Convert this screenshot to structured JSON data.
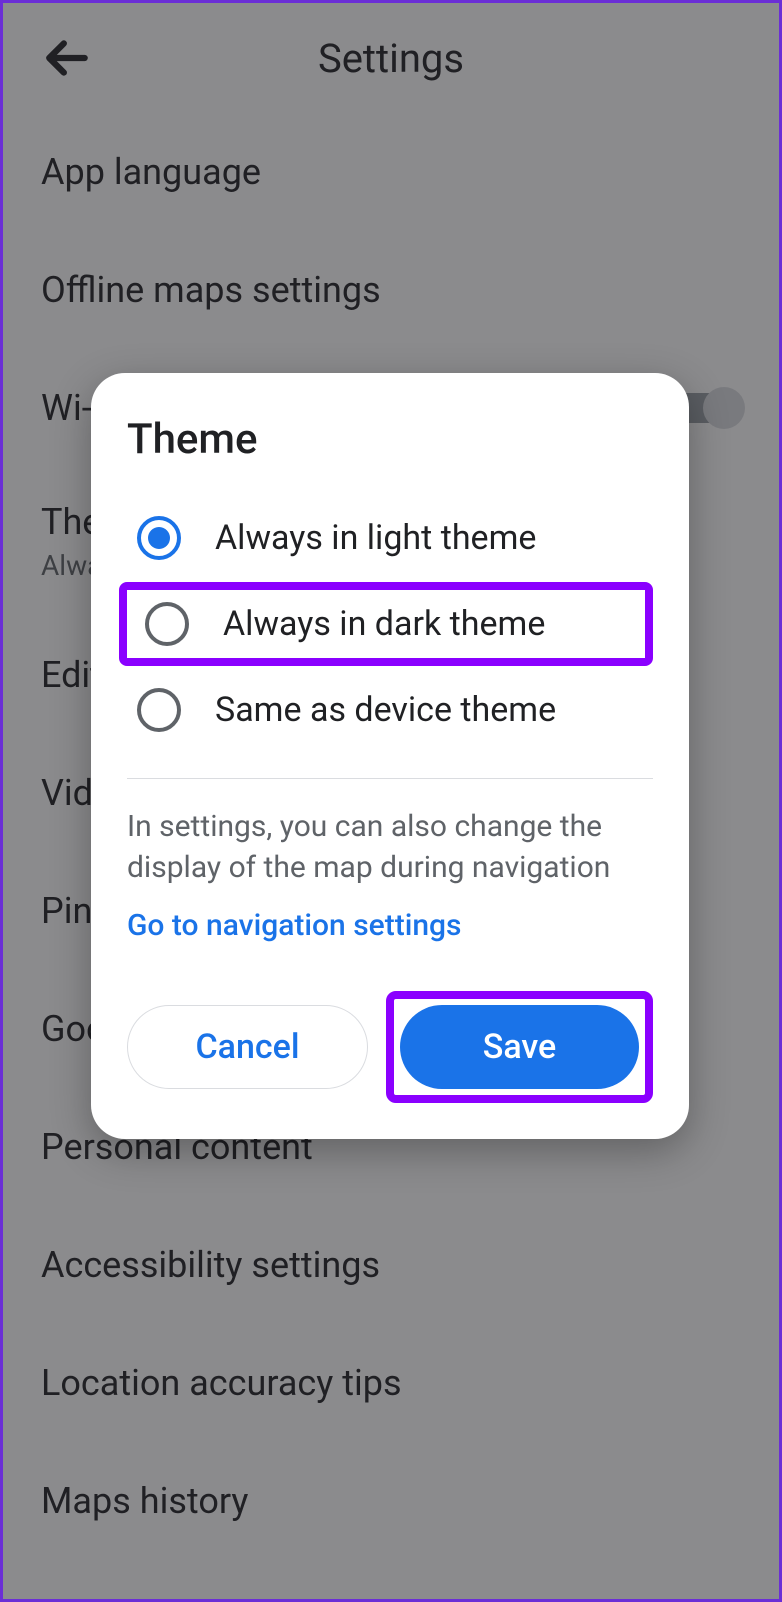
{
  "header": {
    "title": "Settings"
  },
  "list": {
    "items": [
      {
        "label": "App language"
      },
      {
        "label": "Offline maps settings"
      },
      {
        "label": "Wi-Fi only",
        "toggle": true
      },
      {
        "label": "Theme",
        "sub": "Always in light theme"
      },
      {
        "label": "Edit home or work"
      },
      {
        "label": "Video settings"
      },
      {
        "label": "Pinned trips"
      },
      {
        "label": "Google location settings"
      },
      {
        "label": "Personal content"
      },
      {
        "label": "Accessibility settings"
      },
      {
        "label": "Location accuracy tips"
      },
      {
        "label": "Maps history"
      }
    ]
  },
  "dialog": {
    "title": "Theme",
    "options": [
      {
        "label": "Always in light theme",
        "selected": true
      },
      {
        "label": "Always in dark theme",
        "selected": false,
        "highlighted": true
      },
      {
        "label": "Same as device theme",
        "selected": false
      }
    ],
    "info_text": "In settings, you can also change the display of the map during navigation",
    "nav_link": "Go to navigation settings",
    "cancel_label": "Cancel",
    "save_label": "Save"
  }
}
